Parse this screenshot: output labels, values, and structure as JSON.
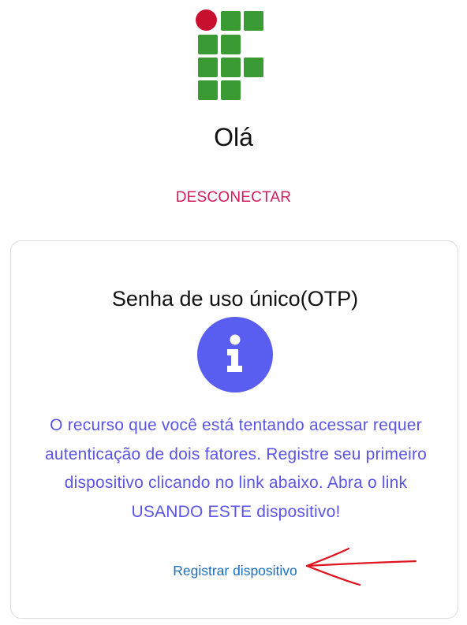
{
  "header": {
    "greeting": "Olá",
    "logout_label": "DESCONECTAR"
  },
  "logo": {
    "icon": "institution-logo-icon",
    "colors": {
      "green": "#3a9b35",
      "red": "#c8102e"
    }
  },
  "card": {
    "title": "Senha de uso único(OTP)",
    "icon": "info-icon",
    "message": "O recurso que você está tentando acessar requer autenticação de dois fatores. Registre seu primeiro dispositivo clicando no link abaixo. Abra o link USANDO ESTE dispositivo!",
    "register_link_label": "Registrar dispositivo"
  },
  "colors": {
    "logout": "#d6195a",
    "icon_bg": "#5a5ef0",
    "message": "#5a55e6",
    "link": "#1b6fbf",
    "annotation": "#e0141e"
  }
}
